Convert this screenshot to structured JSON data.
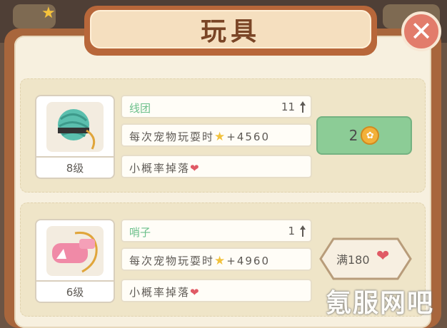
{
  "header": {
    "title": "玩具"
  },
  "close": {
    "label": "✕"
  },
  "items": [
    {
      "name": "线团",
      "count": "11",
      "level": "8级",
      "effect_prefix": "每次宠物玩耍时",
      "effect_value": "+4560",
      "drop_text": "小概率掉落",
      "action": {
        "type": "buy",
        "price": "2"
      }
    },
    {
      "name": "哨子",
      "count": "1",
      "level": "6级",
      "effect_prefix": "每次宠物玩耍时",
      "effect_value": "+4960",
      "drop_text": "小概率掉落",
      "action": {
        "type": "max",
        "label": "满180"
      }
    }
  ],
  "watermark": "氪服网吧",
  "colors": {
    "green_button": "#8ccc96",
    "coin": "#f3b13a",
    "heart": "#e05a65",
    "panel": "#a8663c"
  },
  "icons": {
    "star": "star-icon",
    "heart": "heart-icon",
    "coin": "coin-icon",
    "arrow": "up-arrow-icon"
  }
}
